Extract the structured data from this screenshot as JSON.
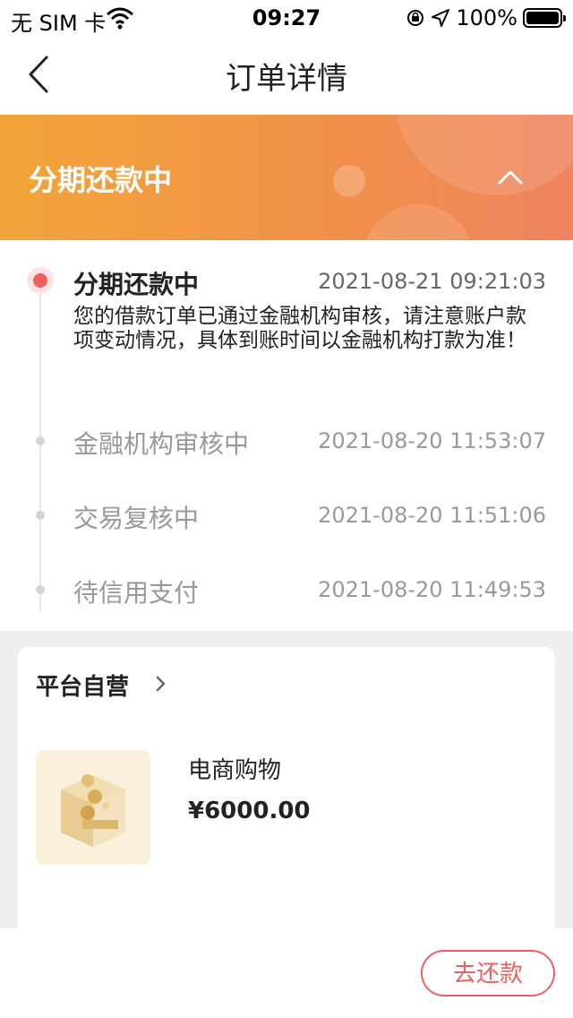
{
  "status_bar": {
    "carrier": "无 SIM 卡",
    "time": "09:27",
    "battery": "100%"
  },
  "nav": {
    "title": "订单详情"
  },
  "banner": {
    "status": "分期还款中"
  },
  "timeline": [
    {
      "name": "分期还款中",
      "time": "2021-08-21 09:21:03",
      "desc": "您的借款订单已通过金融机构审核，请注意账户款项变动情况，具体到账时间以金融机构打款为准！"
    },
    {
      "name": "金融机构审核中",
      "time": "2021-08-20 11:53:07"
    },
    {
      "name": "交易复核中",
      "time": "2021-08-20 11:51:06"
    },
    {
      "name": "待信用支付",
      "time": "2021-08-20 11:49:53"
    }
  ],
  "order": {
    "store": "平台自营",
    "product_name": "电商购物",
    "price": "¥6000.00"
  },
  "actions": {
    "repay_label": "去还款"
  },
  "colors": {
    "accent_red": "#ef5f5f",
    "banner_start": "#f2a53a",
    "banner_end": "#ee8460"
  }
}
